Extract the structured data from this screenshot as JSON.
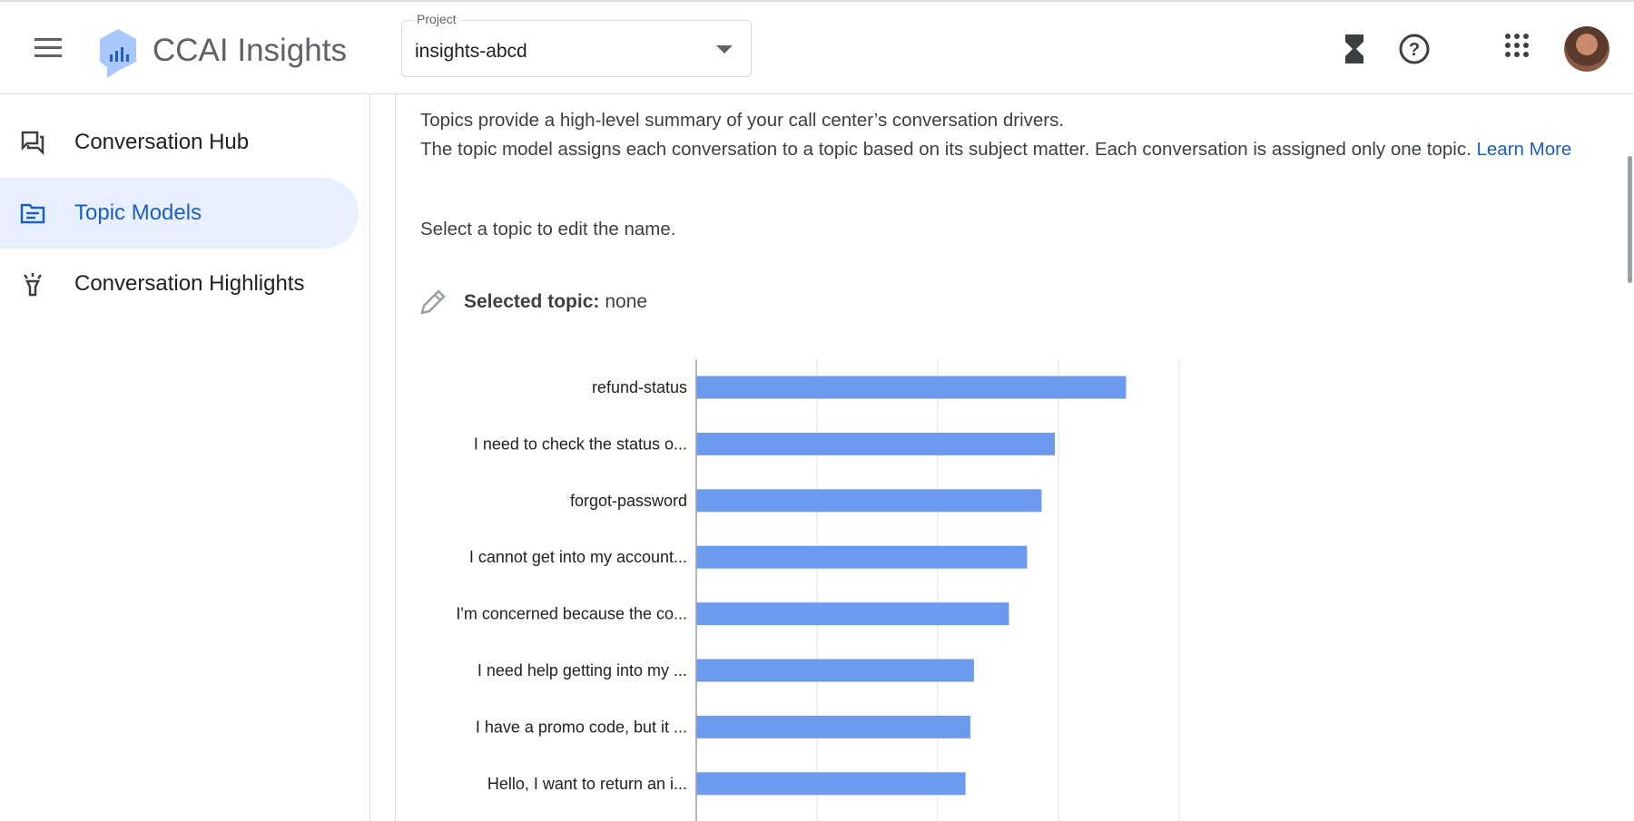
{
  "header": {
    "title": "CCAI Insights",
    "project_label": "Project",
    "project_value": "insights-abcd"
  },
  "sidebar": {
    "items": [
      {
        "label": "Conversation Hub",
        "icon": "forum-icon",
        "active": false
      },
      {
        "label": "Topic Models",
        "icon": "topic-icon",
        "active": true
      },
      {
        "label": "Conversation Highlights",
        "icon": "highlight-icon",
        "active": false
      }
    ]
  },
  "main": {
    "intro1": "Topics provide a high-level summary of your call center’s conversation drivers.",
    "intro2": "The topic model assigns each conversation to a topic based on its subject matter. Each conversation is assigned only one topic.",
    "learn_more": "Learn More",
    "instruction": "Select a topic to edit the name.",
    "selected_label": "Selected topic:",
    "selected_value": "none"
  },
  "colors": {
    "bar": "#6b9aef",
    "accent": "#1a5fc8"
  },
  "chart_data": {
    "type": "bar",
    "orientation": "horizontal",
    "categories": [
      "refund-status",
      "I need to check the status o...",
      "forgot-password",
      "I cannot get into my account...",
      "I'm concerned because the co...",
      "I need help getting into my ...",
      "I have a promo code, but it ...",
      "Hello, I want to return an i..."
    ],
    "values": [
      3.56,
      2.97,
      2.86,
      2.74,
      2.59,
      2.3,
      2.27,
      2.23
    ],
    "xlim": [
      0,
      4
    ],
    "grid": true
  }
}
